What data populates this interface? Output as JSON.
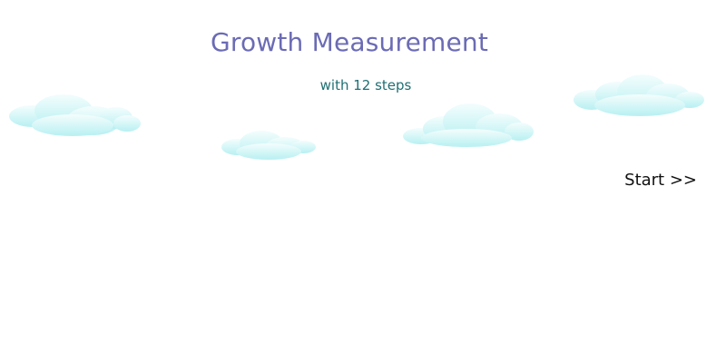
{
  "header": {
    "title": "Growth Measurement",
    "subtitle": "with 12 steps"
  },
  "actions": {
    "start_label": "Start >>"
  },
  "colors": {
    "title": "#6b6bb5",
    "subtitle": "#1f6f73",
    "cloud_top": "#f4fdfd",
    "cloud_bottom": "#b8f0f2"
  }
}
